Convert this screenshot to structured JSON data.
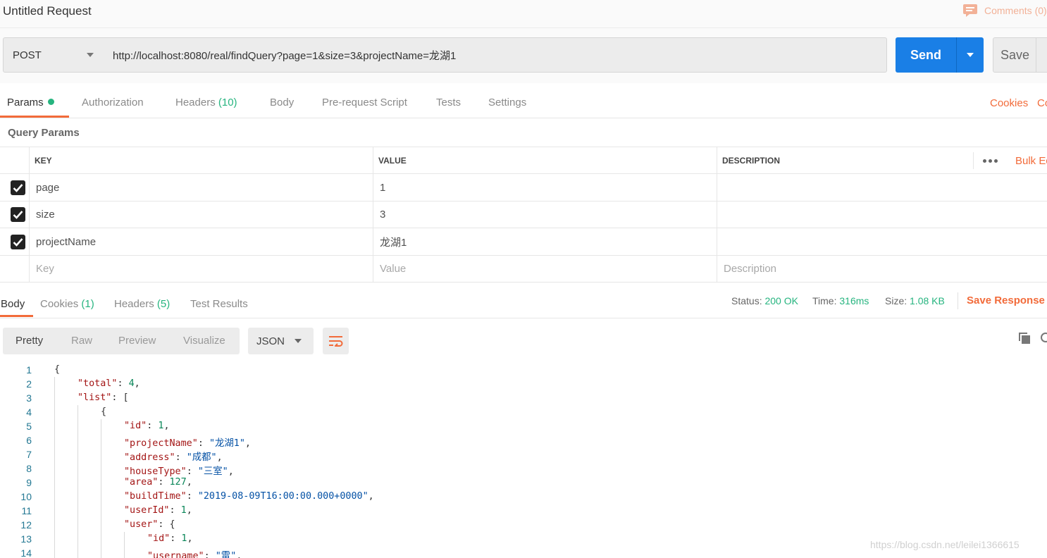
{
  "window": {
    "title": "Untitled Request",
    "comments_label": "Comments (0)"
  },
  "request": {
    "method": "POST",
    "url": "http://localhost:8080/real/findQuery?page=1&size=3&projectName=龙湖1",
    "send_label": "Send",
    "save_label": "Save"
  },
  "request_tabs": {
    "params": "Params",
    "authorization": "Authorization",
    "headers": "Headers",
    "headers_count": "(10)",
    "body": "Body",
    "prerequest": "Pre-request Script",
    "tests": "Tests",
    "settings": "Settings",
    "cookies": "Cookies",
    "code": "Code"
  },
  "query_params": {
    "title": "Query Params",
    "columns": {
      "key": "KEY",
      "value": "VALUE",
      "description": "DESCRIPTION"
    },
    "bulk_edit": "Bulk Edit",
    "rows": [
      {
        "key": "page",
        "value": "1",
        "description": ""
      },
      {
        "key": "size",
        "value": "3",
        "description": ""
      },
      {
        "key": "projectName",
        "value": "龙湖1",
        "description": ""
      }
    ],
    "placeholders": {
      "key": "Key",
      "value": "Value",
      "description": "Description"
    }
  },
  "response": {
    "tabs": {
      "body": "Body",
      "cookies": "Cookies",
      "cookies_count": "(1)",
      "headers": "Headers",
      "headers_count": "(5)",
      "test_results": "Test Results"
    },
    "status_label": "Status:",
    "status_value": "200 OK",
    "time_label": "Time:",
    "time_value": "316ms",
    "size_label": "Size:",
    "size_value": "1.08 KB",
    "save_response": "Save Response",
    "view_modes": {
      "pretty": "Pretty",
      "raw": "Raw",
      "preview": "Preview",
      "visualize": "Visualize"
    },
    "format": "JSON"
  },
  "watermark": "https://blog.csdn.net/leilei1366615"
}
